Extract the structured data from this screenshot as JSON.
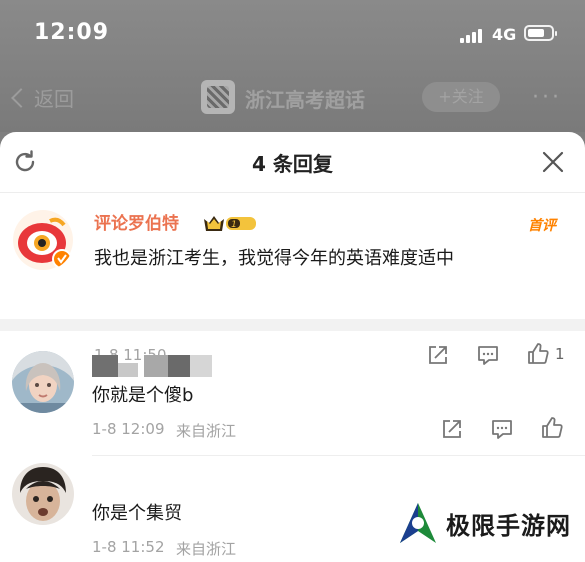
{
  "status_bar": {
    "time": "12:09",
    "network": "4G"
  },
  "nav": {
    "back_label": "返回",
    "topic_title": "浙江高考超话",
    "follow_label": "+关注",
    "more_label": "···"
  },
  "sheet": {
    "title": "4 条回复"
  },
  "main_comment": {
    "username": "评论罗伯特",
    "badge_level": "1",
    "tag": "首评",
    "text": "我也是浙江考生，我觉得今年的英语难度适中",
    "timestamp": "1-8 11:50",
    "like_count": "1"
  },
  "replies": [
    {
      "text": "你就是个傻b",
      "timestamp": "1-8 12:09",
      "location": "来自浙江"
    },
    {
      "text": "你是个集贸",
      "timestamp": "1-8 11:52",
      "location": "来自浙江"
    }
  ],
  "watermark": {
    "text": "极限手游网"
  },
  "colors": {
    "username_orange": "#eb7350",
    "tag_orange": "#ff8200",
    "meta_gray": "#a3a3a3",
    "overlay_gray": "#7f7f7f"
  }
}
